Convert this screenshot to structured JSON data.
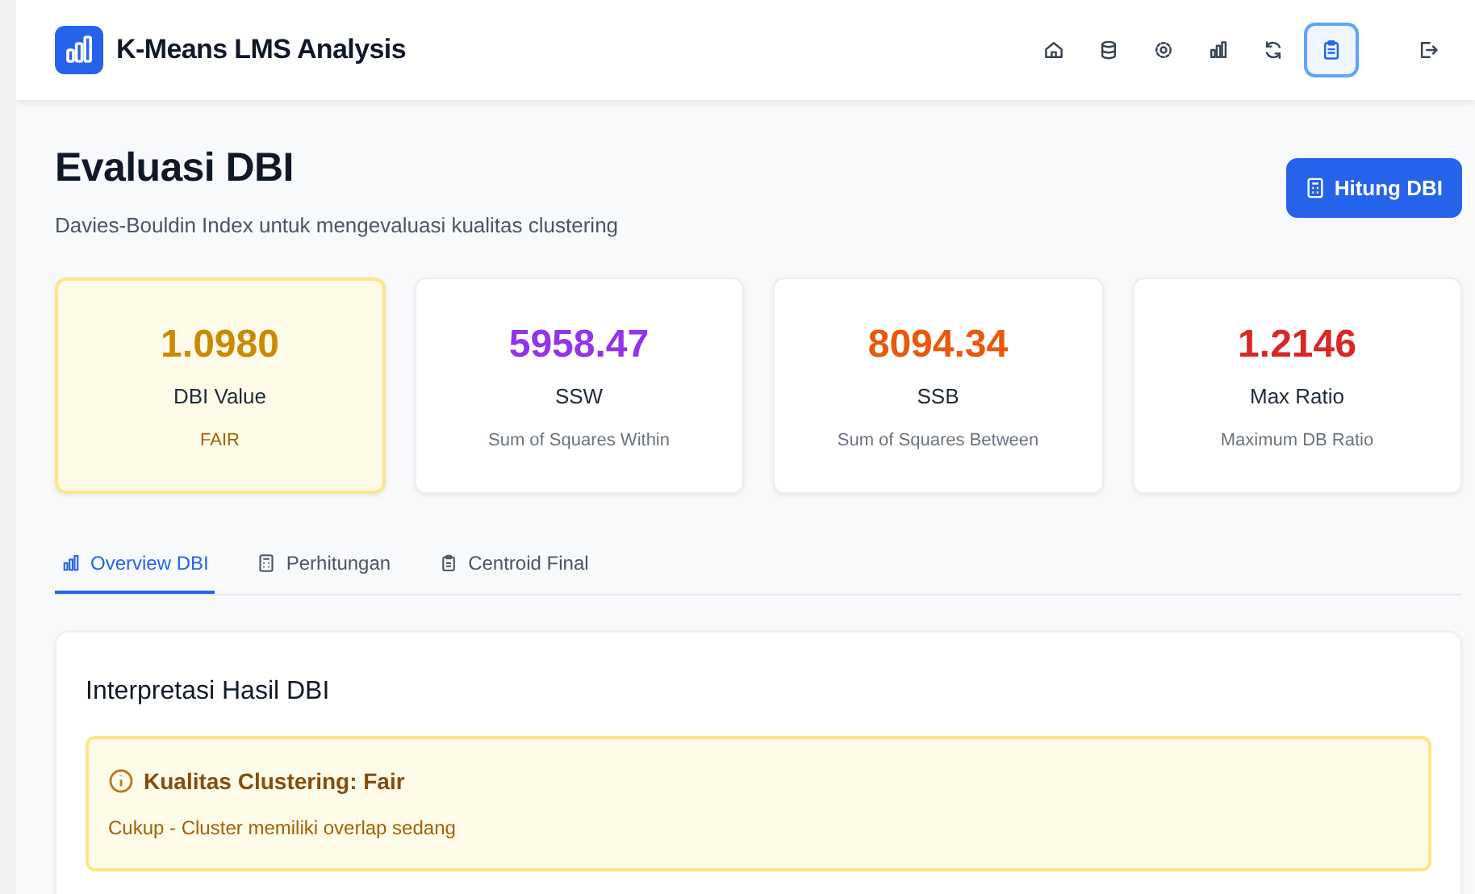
{
  "app": {
    "title": "K-Means LMS Analysis"
  },
  "nav": [
    {
      "selected": false
    },
    {
      "selected": false
    },
    {
      "selected": false
    },
    {
      "selected": false
    },
    {
      "selected": false
    },
    {
      "selected": true
    },
    {
      "selected": false
    }
  ],
  "page": {
    "title": "Evaluasi DBI",
    "subtitle": "Davies-Bouldin Index untuk mengevaluasi kualitas clustering",
    "action": "Hitung DBI"
  },
  "stats": [
    {
      "value": "1.0980",
      "label": "DBI Value",
      "note": "FAIR",
      "color": "#ca8a04",
      "highlighted": true
    },
    {
      "value": "5958.47",
      "label": "SSW",
      "note": "Sum of Squares Within",
      "color": "#9333ea",
      "highlighted": false
    },
    {
      "value": "8094.34",
      "label": "SSB",
      "note": "Sum of Squares Between",
      "color": "#ea580c",
      "highlighted": false
    },
    {
      "value": "1.2146",
      "label": "Max Ratio",
      "note": "Maximum DB Ratio",
      "color": "#dc2626",
      "highlighted": false
    }
  ],
  "tabs": [
    {
      "label": "Overview DBI",
      "selected": true
    },
    {
      "label": "Perhitungan",
      "selected": false
    },
    {
      "label": "Centroid Final",
      "selected": false
    }
  ],
  "panel": {
    "title": "Interpretasi Hasil DBI",
    "alert": {
      "title": "Kualitas Clustering: Fair",
      "text": "Cukup - Cluster memiliki overlap sedang"
    }
  }
}
